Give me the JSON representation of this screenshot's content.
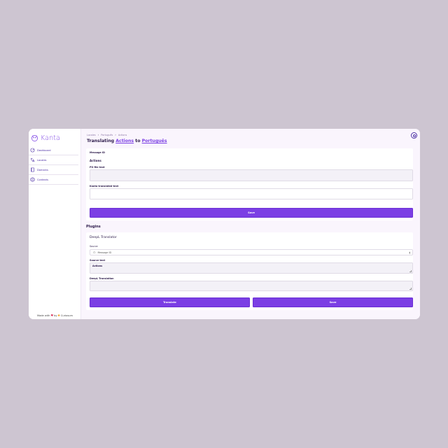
{
  "app": {
    "name": "Kanta"
  },
  "sidebar": {
    "items": [
      {
        "label": "Dashboard",
        "icon": "dashboard-icon"
      },
      {
        "label": "Locales",
        "icon": "translate-icon"
      },
      {
        "label": "Domains",
        "icon": "book-icon"
      },
      {
        "label": "Contexts",
        "icon": "hexagon-icon"
      }
    ],
    "footer": {
      "made_with": "Made with",
      "by": "by",
      "company": "Curiosum"
    }
  },
  "breadcrumb": {
    "items": [
      "Locales",
      "Português",
      "Actions"
    ]
  },
  "header": {
    "title_prefix": "Translating",
    "title_message": "Actions",
    "title_to": "to",
    "title_locale": "Português"
  },
  "form": {
    "message_id_label": "Message ID",
    "message_id_value": "Actions",
    "po_file_text_label": "PO file text",
    "po_file_text_value": "",
    "kanta_translated_label": "Kanta translated text",
    "kanta_translated_value": "",
    "save_label": "Save"
  },
  "plugins": {
    "title": "Plugins",
    "deepl": {
      "title": "DeepL Translator",
      "source_label": "Source",
      "source_selected": "Message ID",
      "source_text_label": "Source text",
      "source_text_value": "Actions",
      "translation_label": "DeepL Translation",
      "translation_value": "",
      "translate_label": "Translate",
      "save_label": "Save"
    }
  },
  "colors": {
    "accent": "#7b3fe4",
    "background": "#cdc5d1",
    "panel": "#faf5fd",
    "heart": "#d61f4d"
  }
}
